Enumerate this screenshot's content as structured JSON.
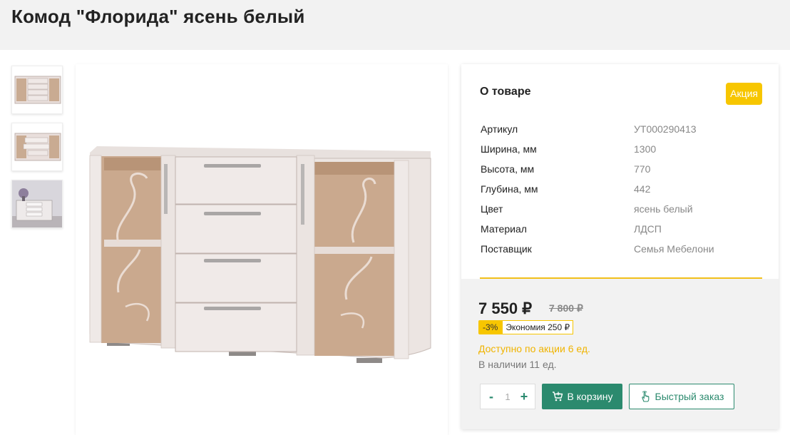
{
  "product": {
    "title": "Комод \"Флорида\" ясень белый"
  },
  "about": {
    "title": "О товаре",
    "badge": "Акция",
    "properties": [
      {
        "key": "Артикул",
        "value": "УТ000290413"
      },
      {
        "key": "Ширина, мм",
        "value": "1300"
      },
      {
        "key": "Высота, мм",
        "value": "770"
      },
      {
        "key": "Глубина, мм",
        "value": "442"
      },
      {
        "key": "Цвет",
        "value": "ясень белый"
      },
      {
        "key": "Материал",
        "value": "ЛДСП"
      },
      {
        "key": "Поставщик",
        "value": "Семья Мебелони"
      }
    ]
  },
  "buy": {
    "price": "7 550 ₽",
    "old_price": "7 800 ₽",
    "discount": "-3%",
    "savings": "Экономия 250 ₽",
    "promo_available": "Доступно по акции 6 ед.",
    "in_stock": "В наличии 11 ед.",
    "qty_minus": "-",
    "qty_value": "1",
    "qty_plus": "+",
    "cart_label": "В корзину",
    "quick_order_label": "Быстрый заказ"
  },
  "icons": {
    "cart": "cart-icon",
    "quick_order": "hand-pointer-icon"
  },
  "colors": {
    "accent_green": "#2b8a6e",
    "promo_yellow": "#f7c600",
    "divider_yellow": "#f2c01b"
  }
}
